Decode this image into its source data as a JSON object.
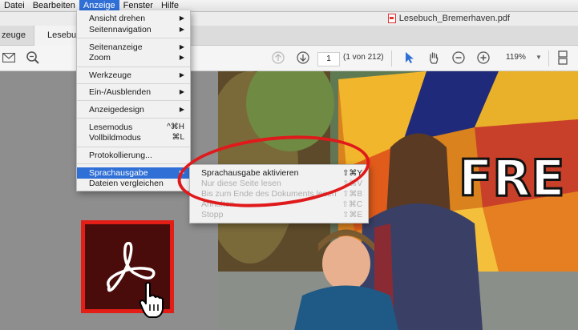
{
  "menubar": {
    "items": [
      "Datei",
      "Bearbeiten",
      "Anzeige",
      "Fenster",
      "Hilfe"
    ],
    "active_index": 2
  },
  "document": {
    "filename": "Lesebuch_Bremerhaven.pdf"
  },
  "tabs": [
    "zeuge",
    "Lesebu"
  ],
  "toolbar": {
    "page_number": "1",
    "page_count": "(1 von 212)",
    "zoom": "119%"
  },
  "menu": {
    "items": [
      {
        "label": "Ansicht drehen",
        "submenu": true
      },
      {
        "label": "Seitennavigation",
        "submenu": true
      },
      {
        "label": "Seitenanzeige",
        "submenu": true
      },
      {
        "label": "Zoom",
        "submenu": true
      },
      {
        "label": "Werkzeuge",
        "submenu": true
      },
      {
        "label": "Ein-/Ausblenden",
        "submenu": true
      },
      {
        "label": "Anzeigedesign",
        "submenu": true
      },
      {
        "label": "Lesemodus",
        "shortcut": "^⌘H"
      },
      {
        "label": "Vollbildmodus",
        "shortcut": "⌘L"
      },
      {
        "label": "Protokollierung..."
      },
      {
        "label": "Sprachausgabe",
        "submenu": true,
        "highlighted": true
      },
      {
        "label": "Dateien vergleichen"
      }
    ]
  },
  "submenu": {
    "items": [
      {
        "label": "Sprachausgabe aktivieren",
        "shortcut": "⇧⌘Y",
        "enabled": true
      },
      {
        "label": "Nur diese Seite lesen",
        "shortcut": "⇧⌘V",
        "enabled": false
      },
      {
        "label": "Bis zum Ende des Dokuments lesen",
        "shortcut": "⇧⌘B",
        "enabled": false
      },
      {
        "label": "Anhalten",
        "shortcut": "⇧⌘C",
        "enabled": false
      },
      {
        "label": "Stopp",
        "shortcut": "⇧⌘E",
        "enabled": false
      }
    ]
  },
  "colors": {
    "menu_highlight": "#2f6fd6",
    "annotation_red": "#e0191b",
    "acrobat_red": "#e21e17"
  },
  "icons": [
    "mail-icon",
    "search-zoom-icon",
    "page-up-icon",
    "page-down-icon",
    "select-arrow-icon",
    "hand-icon",
    "zoom-out-icon",
    "zoom-in-icon",
    "page-layout-icon",
    "pdf-file-icon",
    "acrobat-logo",
    "hand-cursor-icon"
  ]
}
